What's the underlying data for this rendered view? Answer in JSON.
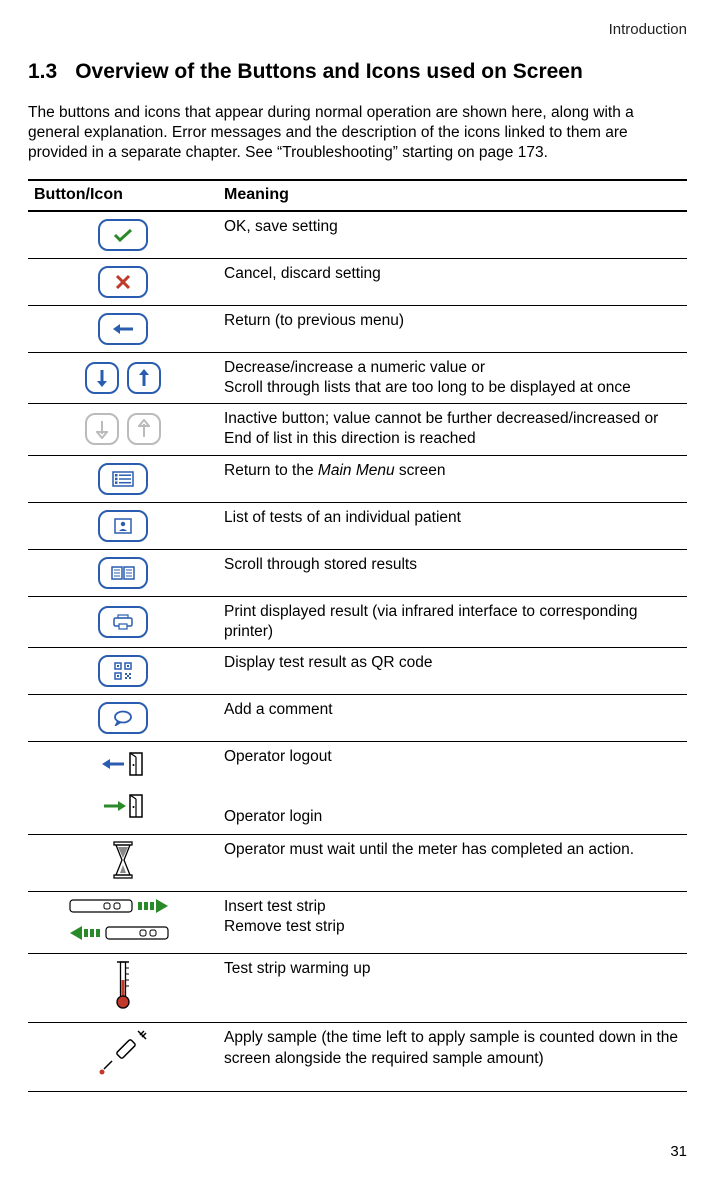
{
  "header": {
    "section": "Introduction"
  },
  "title": {
    "number": "1.3",
    "text": "Overview of the Buttons and Icons used on Screen"
  },
  "intro": "The buttons and icons that appear during normal operation are shown here, along with a general explanation. Error messages and the description of the icons linked to them are provided in a separate chapter. See “Troubleshooting” starting on page 173.",
  "table": {
    "head": {
      "col1": "Button/Icon",
      "col2": "Meaning"
    },
    "rows": [
      {
        "icon": "ok",
        "meaning": "OK, save setting"
      },
      {
        "icon": "cancel",
        "meaning": "Cancel, discard setting"
      },
      {
        "icon": "return",
        "meaning": "Return (to previous menu)"
      },
      {
        "icon": "dec-inc",
        "meaning_line1": "Decrease/increase a numeric value or",
        "meaning_line2": "Scroll through lists that are too long to be displayed at once"
      },
      {
        "icon": "dec-inc-inactive",
        "meaning_line1": "Inactive button; value cannot be further decreased/increased or",
        "meaning_line2": "End of list in this direction is reached"
      },
      {
        "icon": "main-menu",
        "meaning_pre": "Return to the ",
        "meaning_em": "Main Menu",
        "meaning_post": " screen"
      },
      {
        "icon": "patient-list",
        "meaning": "List of tests of an individual patient"
      },
      {
        "icon": "scroll-results",
        "meaning": "Scroll through stored results"
      },
      {
        "icon": "print",
        "meaning": "Print displayed result (via infrared interface to corresponding printer)"
      },
      {
        "icon": "qr",
        "meaning": "Display test result as QR code"
      },
      {
        "icon": "comment",
        "meaning": "Add a comment"
      },
      {
        "icon": "logout-login",
        "meaning_line1": "Operator logout",
        "meaning_line2": "Operator login"
      },
      {
        "icon": "hourglass",
        "meaning": "Operator must wait until the meter has completed an action."
      },
      {
        "icon": "strip",
        "meaning_line1": "Insert test strip",
        "meaning_line2": "Remove test strip"
      },
      {
        "icon": "thermometer",
        "meaning": "Test strip warming up"
      },
      {
        "icon": "syringe",
        "meaning": "Apply sample (the time left to apply sample is counted down in the screen alongside the required sample amount)"
      }
    ]
  },
  "page_number": "31"
}
